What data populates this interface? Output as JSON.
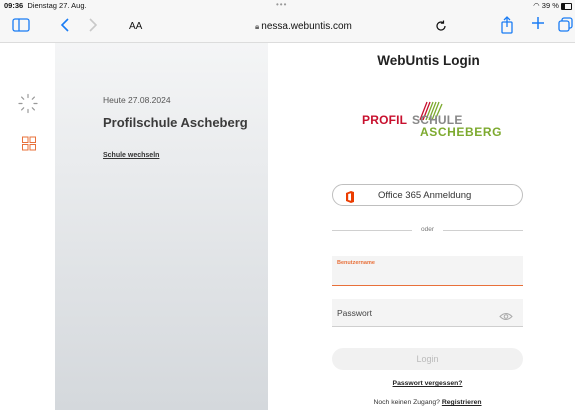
{
  "status_bar": {
    "time": "09:36",
    "date": "Dienstag 27. Aug.",
    "battery": "39 %"
  },
  "browser": {
    "text_size_label": "AA",
    "url": "nessa.webuntis.com",
    "icons": [
      "sidebar-icon",
      "back-icon",
      "forward-icon",
      "lock-icon",
      "reload-icon",
      "share-icon",
      "new-tab-icon",
      "tabs-icon"
    ]
  },
  "side_panel": {
    "date_label": "Heute 27.08.2024",
    "school_name": "Profilschule Ascheberg",
    "change_school": "Schule wechseln"
  },
  "login": {
    "title": "WebUntis Login",
    "logo": {
      "line1_red": "PROFIL",
      "line1_gray": "SCHULE",
      "line2_green": "ASCHEBERG"
    },
    "office_button": "Office 365 Anmeldung",
    "divider_text": "oder",
    "username_label": "Benutzername",
    "username_value": "",
    "password_placeholder": "Passwort",
    "login_button": "Login",
    "forgot_password": "Passwort vergessen?",
    "no_account_text": "Noch keinen Zugang?",
    "register_link": "Registrieren"
  },
  "colors": {
    "accent": "#1a7cf4",
    "username_underline": "#e8703a",
    "logo_red": "#c8102e",
    "logo_green": "#7daa2f",
    "office": "#eb3c00"
  }
}
